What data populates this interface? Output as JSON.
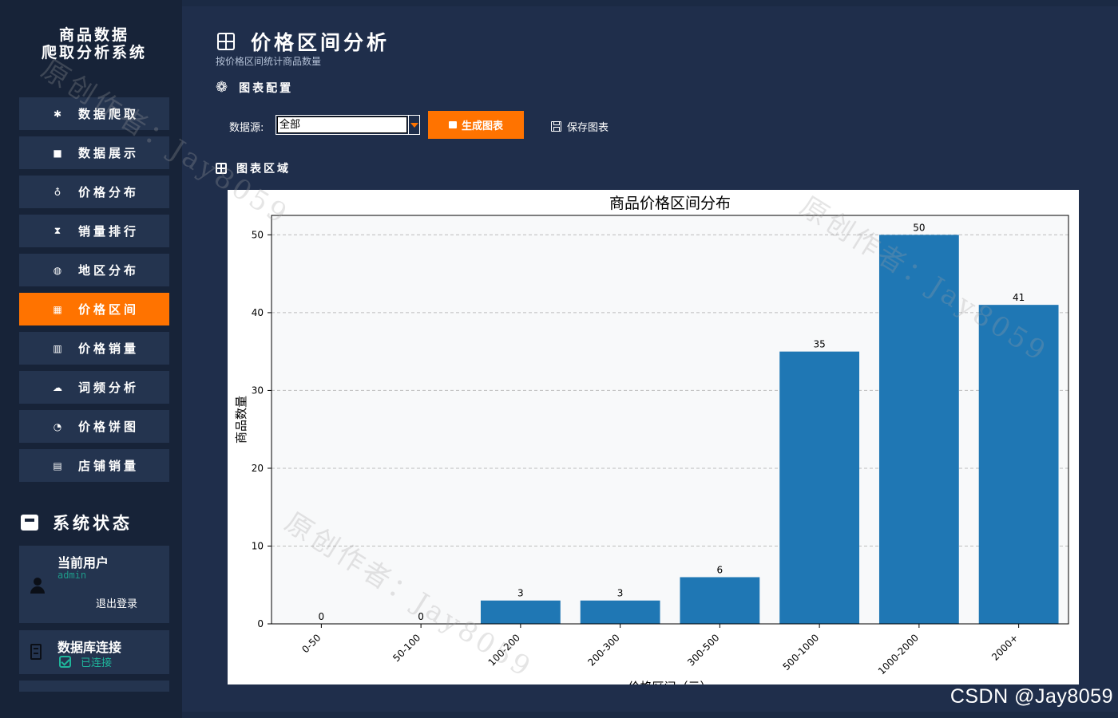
{
  "sidebar": {
    "app_title_line1": "商品数据",
    "app_title_line2": "爬取分析系统",
    "nav": [
      {
        "label": "数据爬取",
        "icon": "spider-icon",
        "glyph": "✱"
      },
      {
        "label": "数据展示",
        "icon": "box-icon",
        "glyph": "■"
      },
      {
        "label": "价格分布",
        "icon": "moneybag-icon",
        "glyph": "♁"
      },
      {
        "label": "销量排行",
        "icon": "trophy-icon",
        "glyph": "⧗"
      },
      {
        "label": "地区分布",
        "icon": "globe-icon",
        "glyph": "◍"
      },
      {
        "label": "价格区间",
        "icon": "grid-chart-icon",
        "glyph": "▦"
      },
      {
        "label": "价格销量",
        "icon": "table-icon",
        "glyph": "▥"
      },
      {
        "label": "词频分析",
        "icon": "cloud-icon",
        "glyph": "☁"
      },
      {
        "label": "价格饼图",
        "icon": "pie-icon",
        "glyph": "◔"
      },
      {
        "label": "店铺销量",
        "icon": "store-icon",
        "glyph": "▤"
      }
    ],
    "active_index": 5,
    "status_title": "系统状态",
    "user_label": "当前用户",
    "user_name": "admin",
    "logout_label": "退出登录",
    "db_label": "数据库连接",
    "db_status": "已连接"
  },
  "main": {
    "title": "价格区间分析",
    "subtitle": "按价格区间统计商品数量",
    "config_title": "图表配置",
    "datasource_label": "数据源:",
    "datasource_value": "全部",
    "generate_label": "生成图表",
    "save_label": "保存图表",
    "area_title": "图表区域"
  },
  "watermark": "CSDN @Jay8059",
  "diag_watermark": "原创作者：Jay8059",
  "colors": {
    "accent": "#ff7300",
    "bar": "#1f77b4",
    "sidebar": "#172338",
    "main": "#1f2e4b"
  },
  "chart_data": {
    "type": "bar",
    "title": "商品价格区间分布",
    "xlabel": "价格区间（元）",
    "ylabel": "商品数量",
    "categories": [
      "0-50",
      "50-100",
      "100-200",
      "200-300",
      "300-500",
      "500-1000",
      "1000-2000",
      "2000+"
    ],
    "values": [
      0,
      0,
      3,
      3,
      6,
      35,
      50,
      41
    ],
    "ylim": [
      0,
      52.5
    ],
    "yticks": [
      0,
      10,
      20,
      30,
      40,
      50
    ],
    "grid": "y-dashed",
    "data_labels": true
  }
}
